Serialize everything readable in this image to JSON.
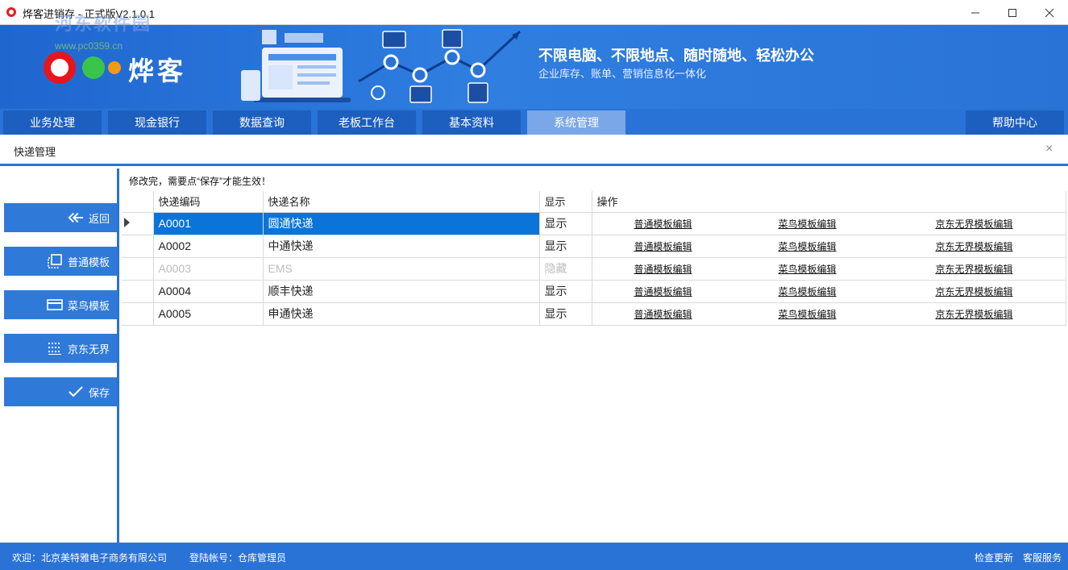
{
  "window": {
    "title": "烨客进销存 - 正式版V2.1.0.1",
    "watermark_title": "河东软件园",
    "watermark_url": "www.pc0359.cn"
  },
  "banner": {
    "logo_text": "烨客",
    "slogan": "不限电脑、不限地点、随时随地、轻松办公",
    "subtitle": "企业库存、账单、营销信息化一体化"
  },
  "nav": {
    "tabs": [
      {
        "label": "业务处理"
      },
      {
        "label": "现金银行"
      },
      {
        "label": "数据查询"
      },
      {
        "label": "老板工作台"
      },
      {
        "label": "基本资料"
      },
      {
        "label": "系统管理"
      }
    ],
    "active_tab": "系统管理",
    "help_label": "帮助中心"
  },
  "page": {
    "title": "快递管理",
    "close_glyph": "×",
    "notice": "修改完，需要点“保存”才能生效！"
  },
  "sidebar": {
    "buttons": [
      {
        "label": "返回",
        "icon": "back-arrows-icon"
      },
      {
        "label": "普通模板",
        "icon": "copy-template-icon"
      },
      {
        "label": "菜鸟模板",
        "icon": "card-icon"
      },
      {
        "label": "京东无界",
        "icon": "dots-grid-icon"
      },
      {
        "label": "保存",
        "icon": "check-icon"
      }
    ]
  },
  "table": {
    "columns": [
      "快递编码",
      "快递名称",
      "显示",
      "操作"
    ],
    "rows": [
      {
        "code": "A0001",
        "name": "圆通快递",
        "display": "显示",
        "selected": true,
        "hidden": false
      },
      {
        "code": "A0002",
        "name": "中通快递",
        "display": "显示",
        "selected": false,
        "hidden": false
      },
      {
        "code": "A0003",
        "name": "EMS",
        "display": "隐藏",
        "selected": false,
        "hidden": true
      },
      {
        "code": "A0004",
        "name": "顺丰快递",
        "display": "显示",
        "selected": false,
        "hidden": false
      },
      {
        "code": "A0005",
        "name": "申通快递",
        "display": "显示",
        "selected": false,
        "hidden": false
      }
    ],
    "ops": [
      "普通模板编辑",
      "菜鸟模板编辑",
      "京东无界模板编辑"
    ]
  },
  "status": {
    "welcome": "欢迎：北京美特雅电子商务有限公司",
    "account": "登陆帐号：仓库管理员",
    "check_update": "检查更新",
    "customer_service": "客服服务"
  },
  "colors": {
    "brand_blue": "#2a73d6",
    "nav_active": "#7aa7e8",
    "row_selected": "#0a74d8"
  }
}
